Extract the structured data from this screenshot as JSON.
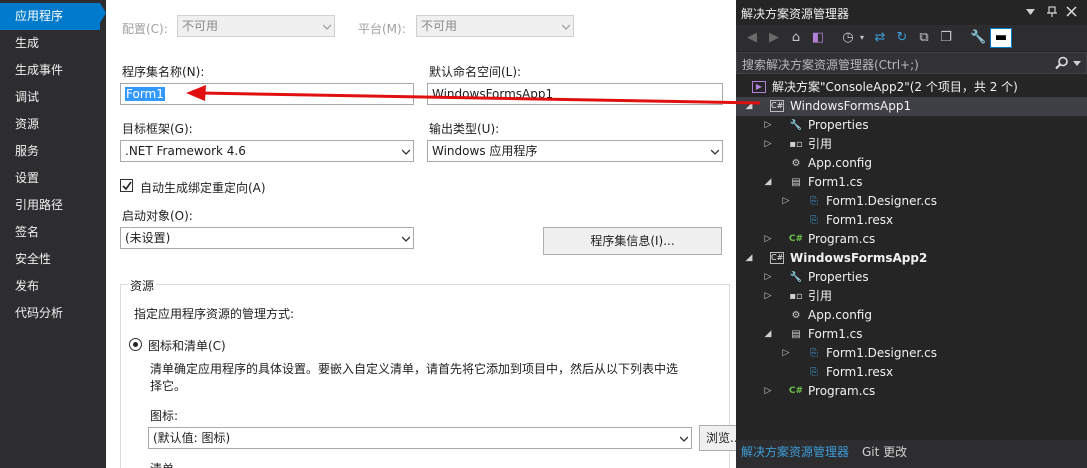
{
  "nav": {
    "items": [
      "应用程序",
      "生成",
      "生成事件",
      "调试",
      "资源",
      "服务",
      "设置",
      "引用路径",
      "签名",
      "安全性",
      "发布",
      "代码分析"
    ],
    "selected_index": 0
  },
  "main": {
    "config_label": "配置(C):",
    "config_value": "不可用",
    "platform_label": "平台(M):",
    "platform_value": "不可用",
    "assembly_name_label": "程序集名称(N):",
    "assembly_name_value": "Form1",
    "default_namespace_label": "默认命名空间(L):",
    "default_namespace_value": "WindowsFormsApp1",
    "target_framework_label": "目标框架(G):",
    "target_framework_value": ".NET Framework 4.6",
    "output_type_label": "输出类型(U):",
    "output_type_value": "Windows 应用程序",
    "auto_binding_label": "自动生成绑定重定向(A)",
    "auto_binding_checked": true,
    "startup_object_label": "启动对象(O):",
    "startup_object_value": "(未设置)",
    "assembly_info_button": "程序集信息(I)...",
    "resources_group_label": "资源",
    "resources_desc": "指定应用程序资源的管理方式:",
    "icon_manifest_label": "图标和清单(C)",
    "icon_manifest_desc_line1": "清单确定应用程序的具体设置。要嵌入自定义清单，请首先将它添加到项目中，然后从以下列表中选",
    "icon_manifest_desc_line2": "择它。",
    "icon_label": "图标:",
    "icon_value": "(默认值: 图标)",
    "browse_button": "浏览...",
    "manifest_label_partial": "清单"
  },
  "solution_explorer": {
    "title": "解决方案资源管理器",
    "search_placeholder": "搜索解决方案资源管理器(Ctrl+;)",
    "solution_label": "解决方案\"ConsoleApp2\"(2 个项目，共 2 个)",
    "tree": [
      {
        "text": "WindowsFormsApp1",
        "icon": "csharp-project-icon",
        "bold": false,
        "expanded": true,
        "selected": true
      },
      {
        "text": "Properties",
        "icon": "wrench-icon"
      },
      {
        "text": "引用",
        "icon": "references-icon"
      },
      {
        "text": "App.config",
        "icon": "config-file-icon"
      },
      {
        "text": "Form1.cs",
        "icon": "form-icon",
        "expanded": true
      },
      {
        "text": "Form1.Designer.cs",
        "icon": "code-file-icon"
      },
      {
        "text": "Form1.resx",
        "icon": "resx-file-icon"
      },
      {
        "text": "Program.cs",
        "icon": "csharp-file-icon"
      },
      {
        "text": "WindowsFormsApp2",
        "icon": "csharp-project-icon",
        "bold": true,
        "expanded": true
      },
      {
        "text": "Properties",
        "icon": "wrench-icon"
      },
      {
        "text": "引用",
        "icon": "references-icon"
      },
      {
        "text": "App.config",
        "icon": "config-file-icon"
      },
      {
        "text": "Form1.cs",
        "icon": "form-icon",
        "expanded": true
      },
      {
        "text": "Form1.Designer.cs",
        "icon": "code-file-icon"
      },
      {
        "text": "Form1.resx",
        "icon": "resx-file-icon"
      },
      {
        "text": "Program.cs",
        "icon": "csharp-file-icon"
      }
    ],
    "tabs": [
      "解决方案资源管理器",
      "Git 更改"
    ],
    "active_tab_index": 0
  },
  "colors": {
    "accent": "#007acc",
    "nav_bg": "#2d2d30",
    "explorer_bg": "#252526",
    "annotation_arrow": "#e01010",
    "selection_bg": "#3f3f46"
  }
}
